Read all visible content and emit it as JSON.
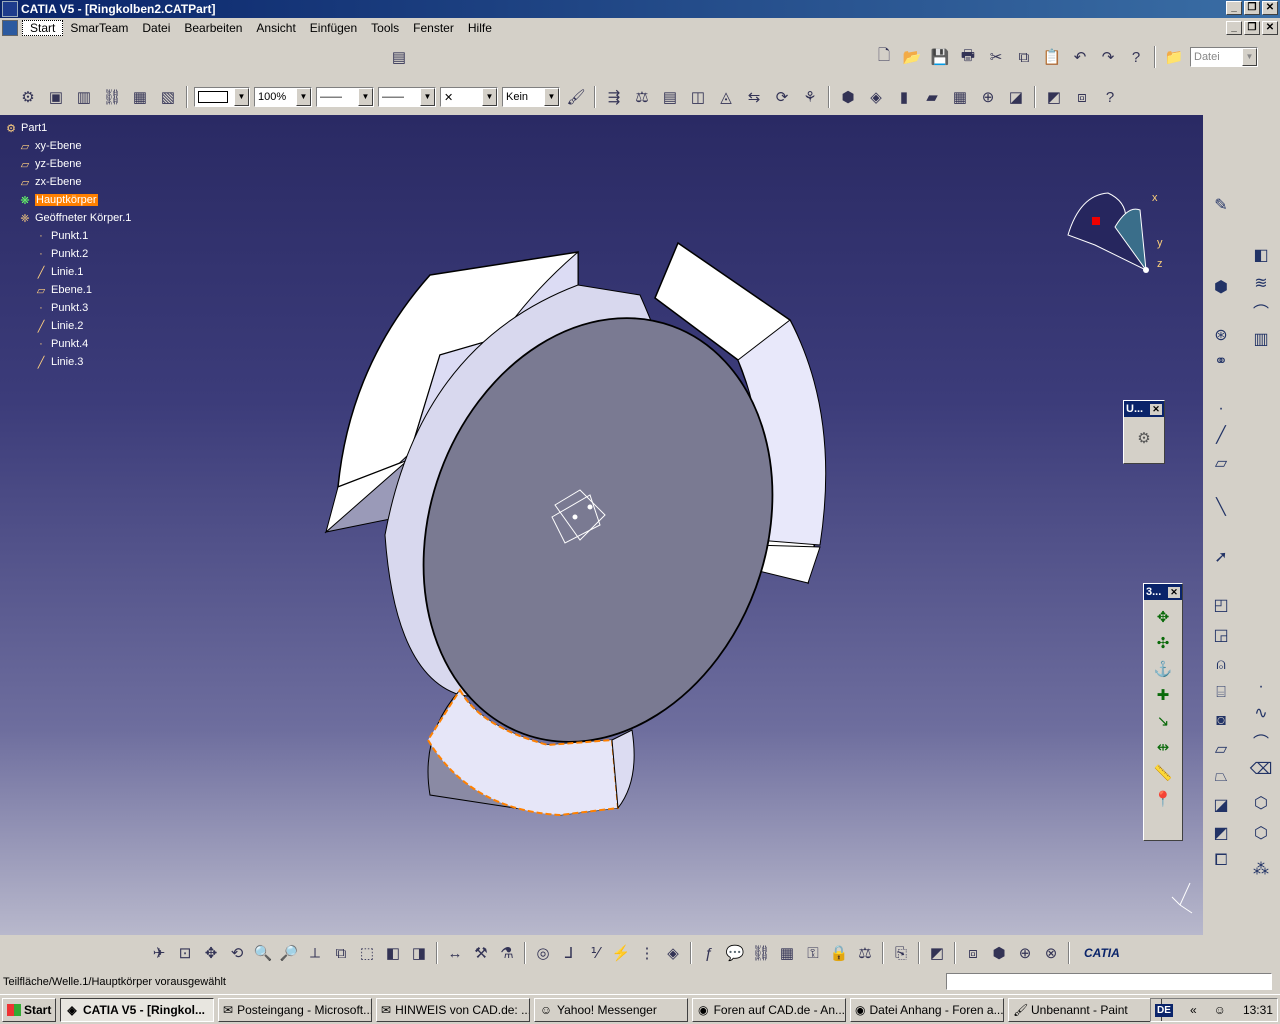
{
  "window": {
    "title": "CATIA V5 - [Ringkolben2.CATPart]",
    "buttons": [
      "_",
      "❐",
      "✕"
    ]
  },
  "menu": [
    "Start",
    "SmarTeam",
    "Datei",
    "Bearbeiten",
    "Ansicht",
    "Einfügen",
    "Tools",
    "Fenster",
    "Hilfe"
  ],
  "toolbar": {
    "line_color": "",
    "zoom_value": "100%",
    "line_style": "——",
    "line_weight": "——",
    "point_symbol": "✕",
    "layer": "Kein",
    "file_combo": "Datei"
  },
  "tree": [
    {
      "label": "Part1",
      "icon": "part-icon",
      "indent": 0,
      "highlight": false
    },
    {
      "label": "xy-Ebene",
      "icon": "plane-icon",
      "indent": 1,
      "highlight": false
    },
    {
      "label": "yz-Ebene",
      "icon": "plane-icon",
      "indent": 1,
      "highlight": false
    },
    {
      "label": "zx-Ebene",
      "icon": "plane-icon",
      "indent": 1,
      "highlight": false
    },
    {
      "label": "Hauptkörper",
      "icon": "body-icon",
      "indent": 1,
      "highlight": true
    },
    {
      "label": "Geöffneter Körper.1",
      "icon": "open-body-icon",
      "indent": 1,
      "highlight": false
    },
    {
      "label": "Punkt.1",
      "icon": "point-icon",
      "indent": 2,
      "highlight": false
    },
    {
      "label": "Punkt.2",
      "icon": "point-icon",
      "indent": 2,
      "highlight": false
    },
    {
      "label": "Linie.1",
      "icon": "line-icon",
      "indent": 2,
      "highlight": false
    },
    {
      "label": "Ebene.1",
      "icon": "plane-icon",
      "indent": 2,
      "highlight": false
    },
    {
      "label": "Punkt.3",
      "icon": "point-icon",
      "indent": 2,
      "highlight": false
    },
    {
      "label": "Linie.2",
      "icon": "line-icon",
      "indent": 2,
      "highlight": false
    },
    {
      "label": "Punkt.4",
      "icon": "point-icon",
      "indent": 2,
      "highlight": false
    },
    {
      "label": "Linie.3",
      "icon": "line-icon",
      "indent": 2,
      "highlight": false
    }
  ],
  "compass_labels": {
    "x": "x",
    "y": "y",
    "z": "z"
  },
  "float_toolbar_u": {
    "title": "U...",
    "close": "✕"
  },
  "float_toolbar_3": {
    "title": "3...",
    "close": "✕"
  },
  "status": {
    "message": "Teilfläche/Welle.1/Hauptkörper vorausgewählt",
    "input": ""
  },
  "taskbar": {
    "start": "Start",
    "tasks": [
      {
        "label": "CATIA V5 - [Ringkol...",
        "active": true
      },
      {
        "label": "Posteingang - Microsoft...",
        "active": false
      },
      {
        "label": "HINWEIS von CAD.de: ...",
        "active": false
      },
      {
        "label": "Yahoo! Messenger",
        "active": false
      },
      {
        "label": "Foren auf CAD.de - An...",
        "active": false
      },
      {
        "label": "Datei Anhang - Foren a...",
        "active": false
      },
      {
        "label": "Unbenannt - Paint",
        "active": false
      }
    ],
    "lang": "DE",
    "clock": "13:31"
  },
  "logo": "CATIA",
  "colors": {
    "selection": "#ff8000",
    "viewport_top": "#2a2a64",
    "viewport_bottom": "#b8b8cc"
  }
}
